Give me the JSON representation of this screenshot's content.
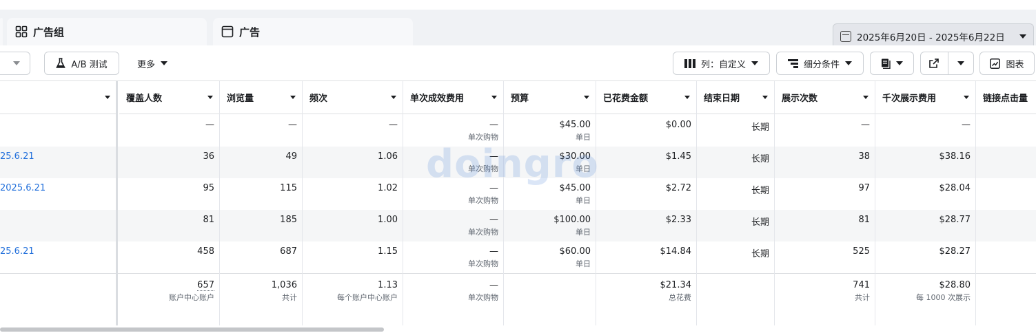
{
  "tabs": [
    {
      "label": "广告组",
      "icon": "grid-icon"
    },
    {
      "label": "广告",
      "icon": "window-icon"
    }
  ],
  "date_range": "2025年6月20日 - 2025年6月22日",
  "toolbar": {
    "ab_test": "A/B 测试",
    "more": "更多",
    "columns": "列：自定义",
    "breakdown": "细分条件",
    "chart": "图表"
  },
  "table": {
    "headers": [
      "覆盖人数",
      "浏览量",
      "频次",
      "单次成效费用",
      "预算",
      "已花费金额",
      "结束日期",
      "展示次数",
      "千次展示费用",
      "链接点击量"
    ],
    "rows": [
      {
        "name": "",
        "reach": "—",
        "views": "—",
        "freq": "—",
        "cpr": "—",
        "cpr_sub": "单次购物",
        "budget": "$45.00",
        "budget_sub": "单日",
        "spent": "$0.00",
        "end": "长期",
        "impr": "—",
        "cpm": "—"
      },
      {
        "name": "25.6.21",
        "reach": "36",
        "views": "49",
        "freq": "1.06",
        "cpr": "—",
        "cpr_sub": "单次购物",
        "budget": "$30.00",
        "budget_sub": "单日",
        "spent": "$1.45",
        "end": "长期",
        "impr": "38",
        "cpm": "$38.16"
      },
      {
        "name": "2025.6.21",
        "reach": "95",
        "views": "115",
        "freq": "1.02",
        "cpr": "—",
        "cpr_sub": "单次购物",
        "budget": "$45.00",
        "budget_sub": "单日",
        "spent": "$2.72",
        "end": "长期",
        "impr": "97",
        "cpm": "$28.04"
      },
      {
        "name": "",
        "reach": "81",
        "views": "185",
        "freq": "1.00",
        "cpr": "—",
        "cpr_sub": "单次购物",
        "budget": "$100.00",
        "budget_sub": "单日",
        "spent": "$2.33",
        "end": "长期",
        "impr": "81",
        "cpm": "$28.77"
      },
      {
        "name": "25.6.21",
        "reach": "458",
        "views": "687",
        "freq": "1.15",
        "cpr": "—",
        "cpr_sub": "单次购物",
        "budget": "$60.00",
        "budget_sub": "单日",
        "spent": "$14.84",
        "end": "长期",
        "impr": "525",
        "cpm": "$28.27"
      }
    ],
    "totals": {
      "reach": "657",
      "reach_sub": "账户中心账户",
      "views": "1,036",
      "views_sub": "共计",
      "freq": "1.13",
      "freq_sub": "每个账户中心账户",
      "cpr": "—",
      "cpr_sub": "单次购物",
      "spent": "$21.34",
      "spent_sub": "总花费",
      "impr": "741",
      "impr_sub": "共计",
      "cpm": "$28.80",
      "cpm_sub": "每 1000 次展示"
    }
  },
  "watermark": "doingro"
}
